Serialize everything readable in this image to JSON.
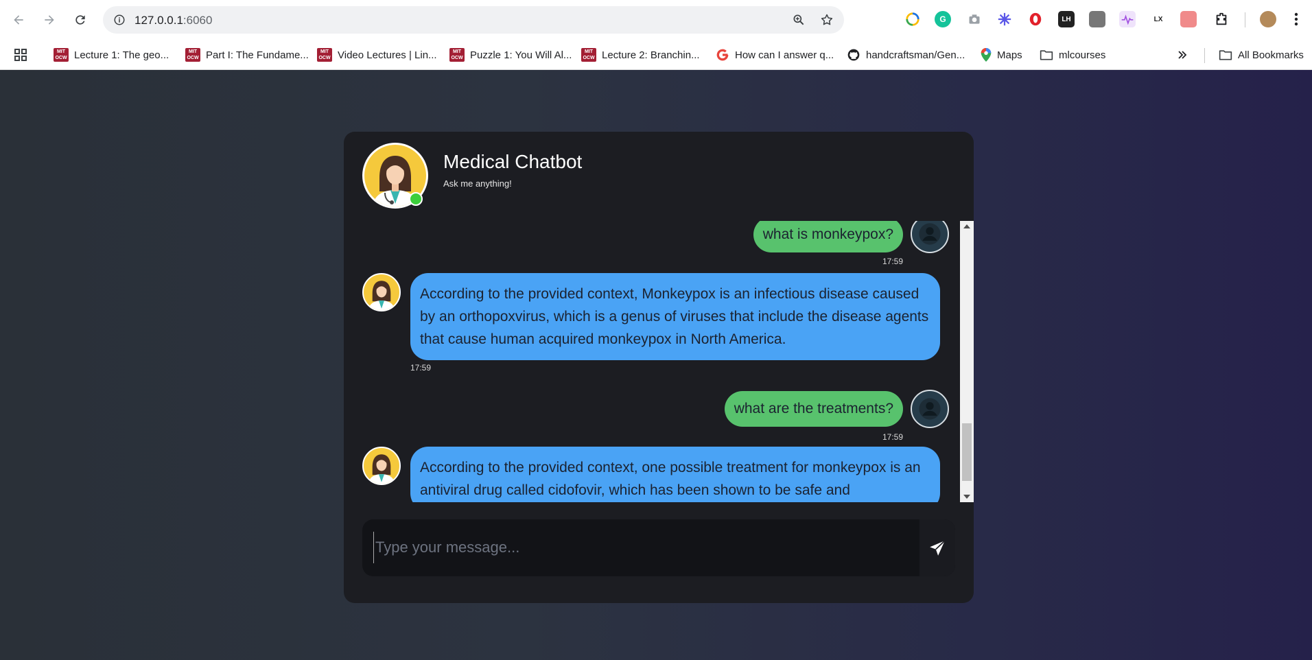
{
  "browser": {
    "url_host": "127.0.0.1",
    "url_port": ":6060",
    "extensions": [
      {
        "icon": "chrome-sync-icon",
        "label": "",
        "color": "#1a73e8"
      },
      {
        "icon": "grammarly-icon",
        "label": "G",
        "color": "#15c39a"
      },
      {
        "icon": "camera-icon",
        "label": "",
        "color": "#9aa0a6"
      },
      {
        "icon": "sparkle-icon",
        "label": "",
        "color": "#5b57e8"
      },
      {
        "icon": "opera-icon",
        "label": "",
        "color": "#e2212b"
      },
      {
        "icon": "lh-icon",
        "label": "LH",
        "color": "#222222"
      },
      {
        "icon": "gray-box-icon",
        "label": "",
        "color": "#777777"
      },
      {
        "icon": "pulse-icon",
        "label": "",
        "color": "#c8a4f0"
      },
      {
        "icon": "lx-icon",
        "label": "LX",
        "color": "#f5b400"
      },
      {
        "icon": "red-pattern-icon",
        "label": "",
        "color": "#f08a8a"
      }
    ],
    "bookmarks": [
      {
        "label": "Lecture 1: The geo...",
        "icon": "mit-ocw-icon"
      },
      {
        "label": "Part I: The Fundame...",
        "icon": "mit-ocw-icon"
      },
      {
        "label": "Video Lectures | Lin...",
        "icon": "mit-ocw-icon"
      },
      {
        "label": "Puzzle 1: You Will Al...",
        "icon": "mit-ocw-icon"
      },
      {
        "label": "Lecture 2: Branchin...",
        "icon": "mit-ocw-icon"
      },
      {
        "label": "How can I answer q...",
        "icon": "google-icon"
      },
      {
        "label": "handcraftsman/Gen...",
        "icon": "github-icon"
      },
      {
        "label": "Maps",
        "icon": "maps-pin-icon"
      },
      {
        "label": "mlcourses",
        "icon": "folder-icon"
      }
    ],
    "all_bookmarks": "All Bookmarks"
  },
  "chat": {
    "title": "Medical Chatbot",
    "subtitle": "Ask me anything!",
    "messages": [
      {
        "from": "user",
        "text": "what is monkeypox?",
        "time": "17:59"
      },
      {
        "from": "bot",
        "text": "According to the provided context, Monkeypox is an infectious disease caused by an orthopoxvirus, which is a genus of viruses that include the disease agents that cause human acquired monkeypox in North America.",
        "time": "17:59"
      },
      {
        "from": "user",
        "text": "what are the treatments?",
        "time": "17:59"
      },
      {
        "from": "bot",
        "text": "According to the provided context, one possible treatment for monkeypox is an antiviral drug called cidofovir, which has been shown to be safe and",
        "time": ""
      }
    ],
    "input_placeholder": "Type your message...",
    "colors": {
      "user_bubble": "#58c26d",
      "bot_bubble": "#4aa3f5",
      "card": "#1c1d22",
      "online": "#3bce3b"
    }
  }
}
